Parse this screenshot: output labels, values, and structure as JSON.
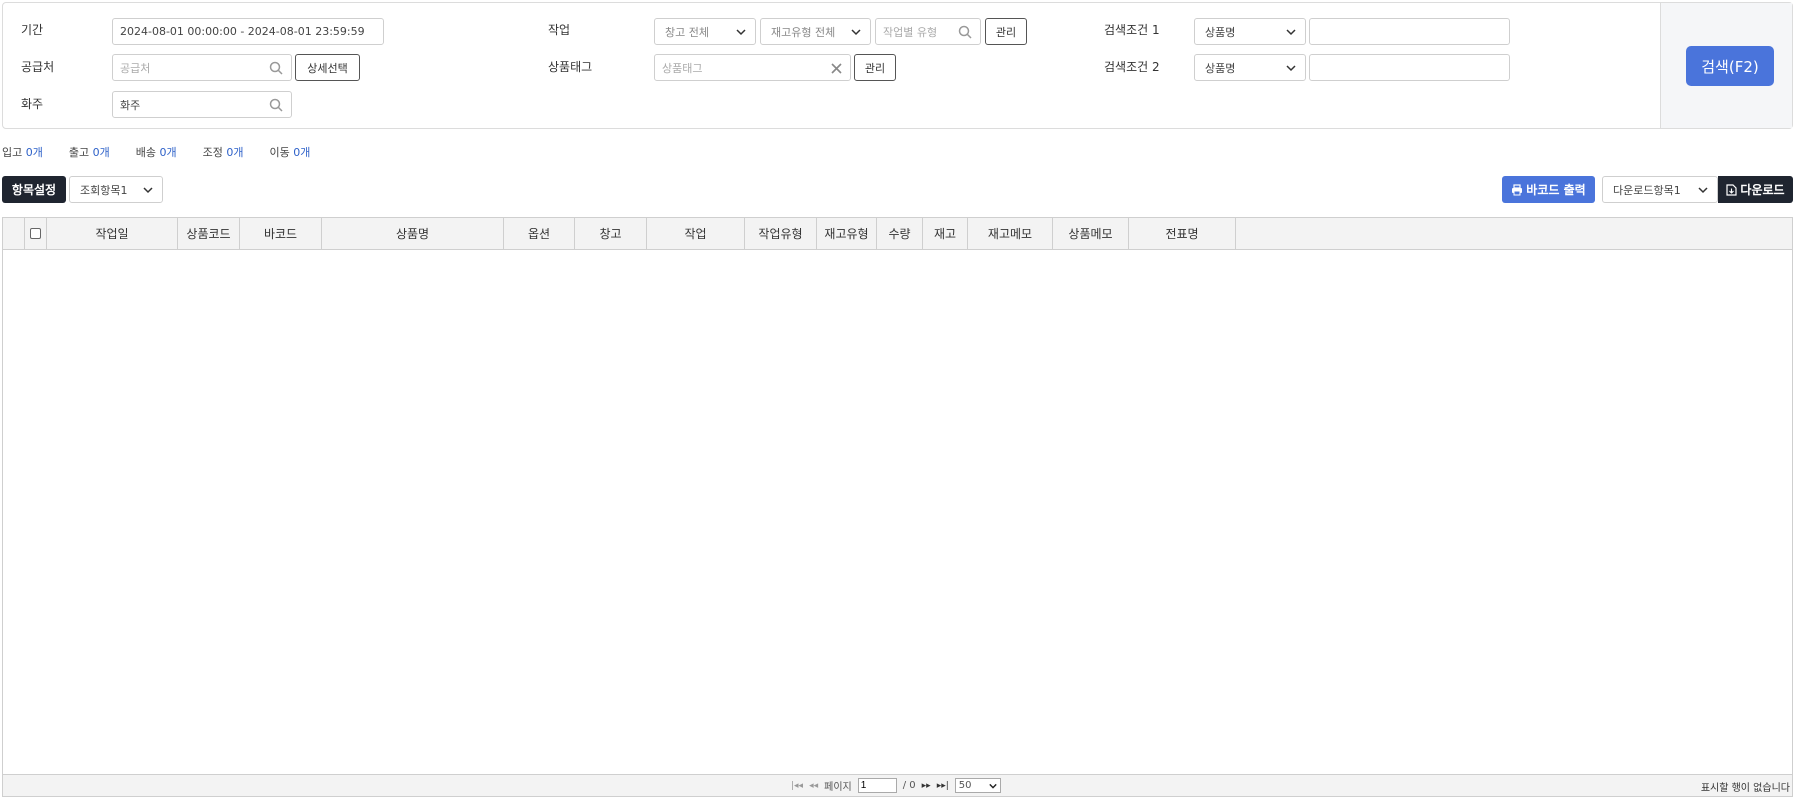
{
  "search": {
    "period": {
      "label": "기간",
      "value": "2024-08-01 00:00:00 - 2024-08-01 23:59:59"
    },
    "supplier": {
      "label": "공급처",
      "placeholder": "공급처",
      "detail_button": "상세선택"
    },
    "owner": {
      "label": "화주",
      "value": "화주"
    },
    "work": {
      "label": "작업",
      "warehouse_select": "창고 전체",
      "stock_type_select": "재고유형 전체",
      "work_type_placeholder": "작업별 유형",
      "manage_button": "관리"
    },
    "product_tag": {
      "label": "상품태그",
      "placeholder": "상품태그",
      "manage_button": "관리"
    },
    "condition1": {
      "label": "검색조건 1",
      "select": "상품명",
      "value": ""
    },
    "condition2": {
      "label": "검색조건 2",
      "select": "상품명",
      "value": ""
    },
    "search_button": "검색(F2)"
  },
  "counts": [
    {
      "label": "입고",
      "value": "0",
      "unit": "개"
    },
    {
      "label": "출고",
      "value": "0",
      "unit": "개"
    },
    {
      "label": "배송",
      "value": "0",
      "unit": "개"
    },
    {
      "label": "조정",
      "value": "0",
      "unit": "개"
    },
    {
      "label": "이동",
      "value": "0",
      "unit": "개"
    }
  ],
  "toolbar": {
    "column_settings": "항목설정",
    "view_preset": "조회항목1",
    "barcode_print": "바코드 출력",
    "download_preset": "다운로드항목1",
    "download": "다운로드"
  },
  "grid": {
    "columns": [
      "작업일",
      "상품코드",
      "바코드",
      "상품명",
      "옵션",
      "창고",
      "작업",
      "작업유형",
      "재고유형",
      "수량",
      "재고",
      "재고메모",
      "상품메모",
      "전표명"
    ]
  },
  "pager": {
    "page_label": "페이지",
    "page_value": "1",
    "total": "/ 0",
    "page_size": "50",
    "empty_message": "표시할 행이 없습니다"
  },
  "colors": {
    "accent": "#4a74db",
    "dark": "#1f2530",
    "count_number": "#2f62c9"
  }
}
